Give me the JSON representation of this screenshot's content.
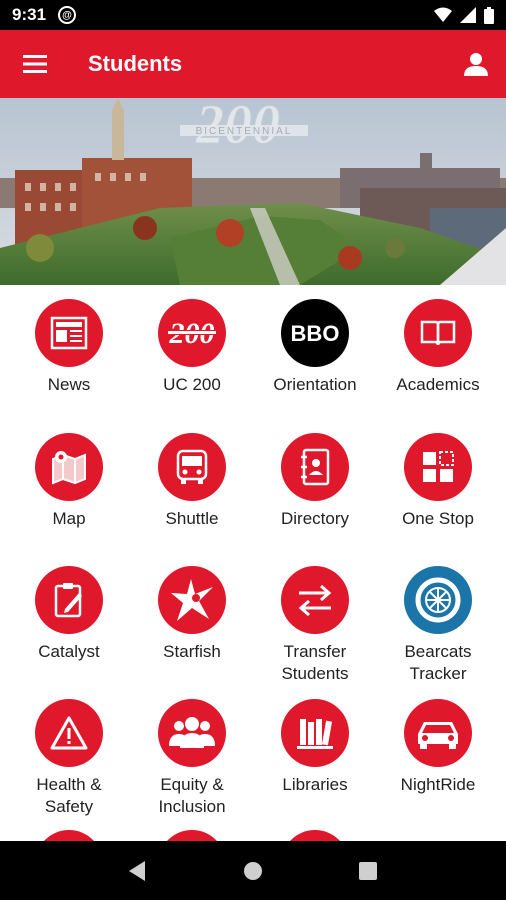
{
  "status_bar": {
    "time": "9:31"
  },
  "app_bar": {
    "title": "Students"
  },
  "banner": {
    "text": "BICENTENNIAL",
    "number": "200"
  },
  "tiles": [
    {
      "label": "News",
      "icon": "news-icon"
    },
    {
      "label": "UC 200",
      "icon": "uc200-icon",
      "badge": "200"
    },
    {
      "label": "Orientation",
      "icon": "orientation-icon",
      "badge": "BBO"
    },
    {
      "label": "Academics",
      "icon": "book-icon"
    },
    {
      "label": "Map",
      "icon": "map-icon"
    },
    {
      "label": "Shuttle",
      "icon": "bus-icon"
    },
    {
      "label": "Directory",
      "icon": "directory-icon"
    },
    {
      "label": "One Stop",
      "icon": "grid-icon"
    },
    {
      "label": "Catalyst",
      "icon": "clipboard-icon"
    },
    {
      "label": "Starfish",
      "icon": "starfish-icon"
    },
    {
      "label": "Transfer\nStudents",
      "icon": "transfer-icon"
    },
    {
      "label": "Bearcats\nTracker",
      "icon": "wheel-icon"
    },
    {
      "label": "Health &\nSafety",
      "icon": "warning-icon"
    },
    {
      "label": "Equity &\nInclusion",
      "icon": "people-icon"
    },
    {
      "label": "Libraries",
      "icon": "library-icon"
    },
    {
      "label": "NightRide",
      "icon": "car-icon"
    }
  ],
  "colors": {
    "brand_red": "#e0182b",
    "tracker_blue": "#1b75a8",
    "black": "#000000"
  }
}
